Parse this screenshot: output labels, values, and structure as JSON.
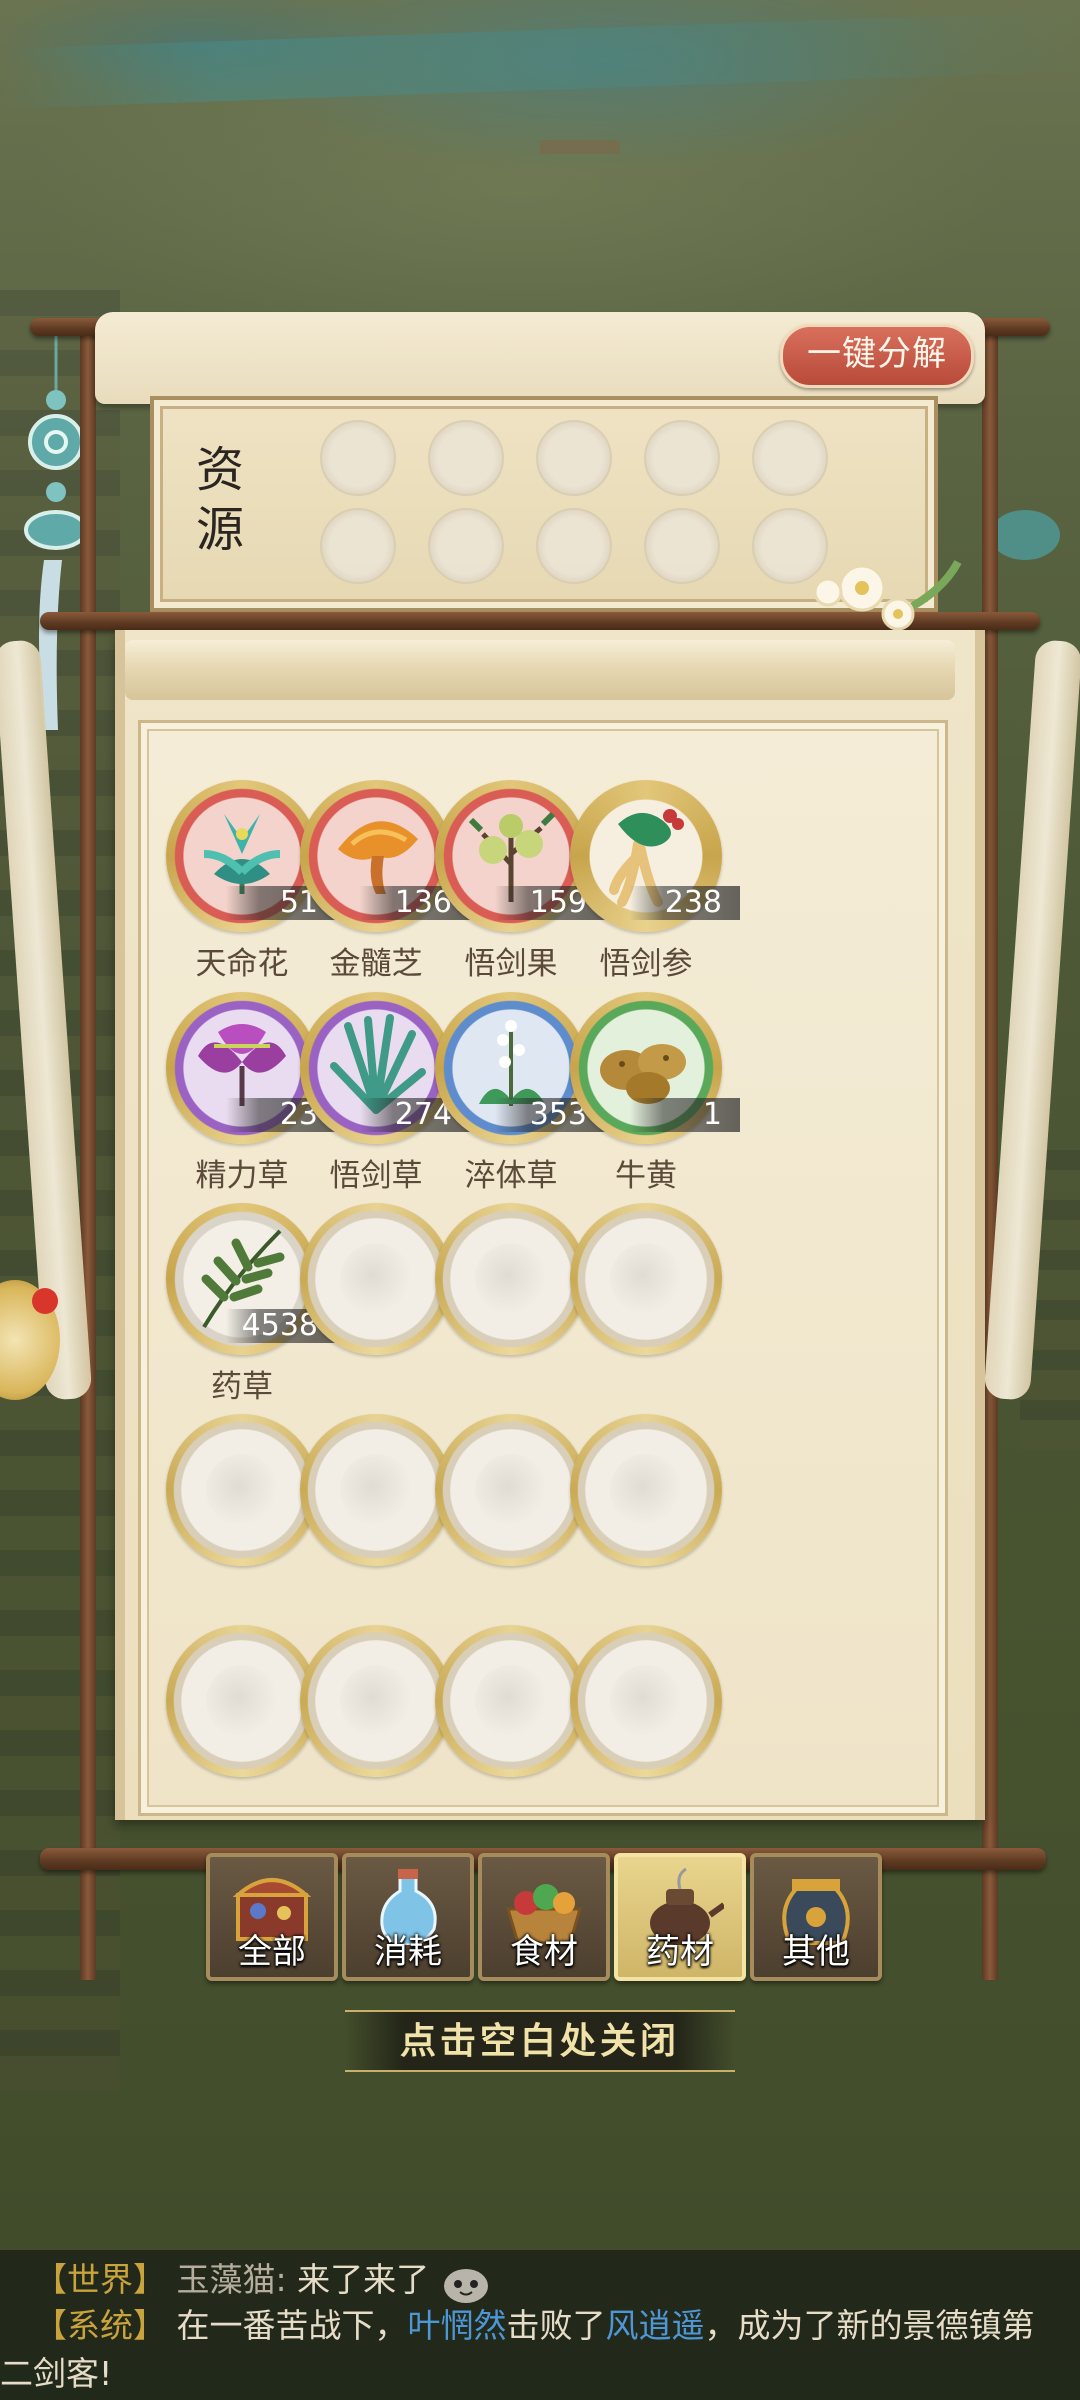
{
  "header": {
    "decompose_button": "一键分解"
  },
  "resources": {
    "label": "资源",
    "slots_count": 10
  },
  "items": [
    {
      "name": "天命花",
      "count": "51",
      "rarity": "red",
      "icon": "teal-lotus-herb-icon"
    },
    {
      "name": "金髓芝",
      "count": "136",
      "rarity": "red",
      "icon": "golden-mushroom-icon"
    },
    {
      "name": "悟剑果",
      "count": "159",
      "rarity": "red",
      "icon": "green-fruit-branch-icon"
    },
    {
      "name": "悟剑参",
      "count": "238",
      "rarity": "gold",
      "icon": "ginseng-root-icon"
    },
    {
      "name": "精力草",
      "count": "23",
      "rarity": "purple",
      "icon": "purple-leaf-herb-icon"
    },
    {
      "name": "悟剑草",
      "count": "274",
      "rarity": "purple",
      "icon": "sword-grass-icon"
    },
    {
      "name": "淬体草",
      "count": "353",
      "rarity": "blue",
      "icon": "white-flower-herb-icon"
    },
    {
      "name": "牛黄",
      "count": "1",
      "rarity": "green",
      "icon": "bezoar-stones-icon"
    },
    {
      "name": "药草",
      "count": "4538",
      "rarity": "white",
      "icon": "leafy-sprig-icon"
    }
  ],
  "tabs": [
    {
      "label": "全部",
      "icon": "treasure-chest-icon",
      "active": false
    },
    {
      "label": "消耗",
      "icon": "potion-bottle-icon",
      "active": false
    },
    {
      "label": "食材",
      "icon": "vegetable-basket-icon",
      "active": false
    },
    {
      "label": "药材",
      "icon": "herb-pot-icon",
      "active": true
    },
    {
      "label": "其他",
      "icon": "gold-urn-icon",
      "active": false
    }
  ],
  "close_hint": "点击空白处关闭",
  "chat": {
    "line1": {
      "tag": "【世界】",
      "speaker": "玉藻猫:",
      "message": "来了来了"
    },
    "line2": {
      "tag": "【系统】",
      "part1": "在一番苦战下，",
      "name1": "叶惘然",
      "part2": "击败了",
      "name2": "风逍遥",
      "part3": "，成为了新的景德镇第",
      "part4": "二剑客!"
    }
  },
  "colors": {
    "accent_red": "#c9564a",
    "gold": "#c9a33c",
    "link_blue": "#4d97d6",
    "parchment": "#f1e7cc"
  }
}
